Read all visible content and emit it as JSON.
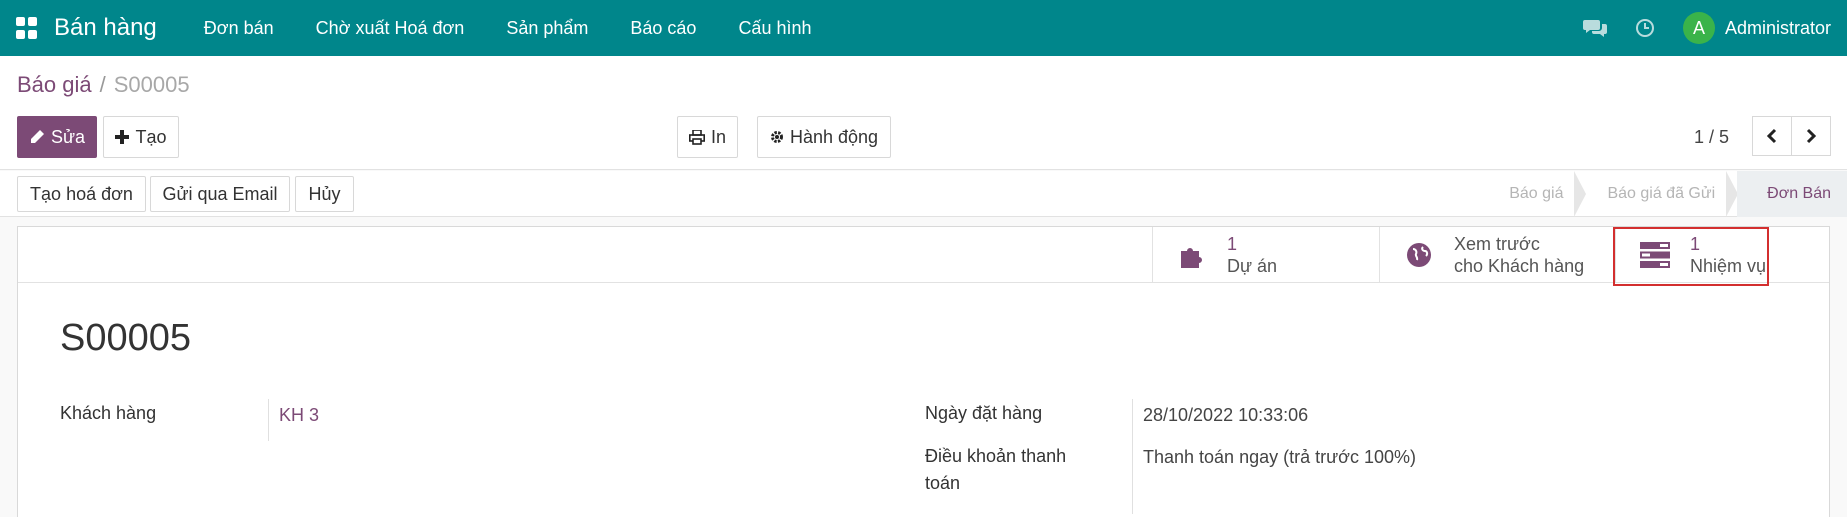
{
  "navbar": {
    "brand": "Bán hàng",
    "menu": [
      "Đơn bán",
      "Chờ xuất Hoá đơn",
      "Sản phẩm",
      "Báo cáo",
      "Cấu hình"
    ],
    "avatar_letter": "A",
    "user": "Administrator"
  },
  "breadcrumb": {
    "parent": "Báo giá",
    "separator": "/",
    "current": "S00005"
  },
  "toolbar": {
    "edit": "Sửa",
    "create": "Tạo",
    "print": "In",
    "action": "Hành động"
  },
  "pager": {
    "text": "1 / 5"
  },
  "statusbar": {
    "actions": [
      "Tạo hoá đơn",
      "Gửi qua Email",
      "Hủy"
    ],
    "steps": [
      "Báo giá",
      "Báo giá đã Gửi",
      "Đơn Bán"
    ]
  },
  "smart_buttons": {
    "project": {
      "value": "1",
      "label": "Dự án"
    },
    "preview": {
      "line1": "Xem trước",
      "line2": "cho Khách hàng"
    },
    "task": {
      "value": "1",
      "label": "Nhiệm vụ"
    }
  },
  "form": {
    "title": "S00005",
    "customer_label": "Khách hàng",
    "customer_value": "KH 3",
    "date_label": "Ngày đặt hàng",
    "date_value": "28/10/2022 10:33:06",
    "terms_label_1": "Điều khoản thanh",
    "terms_label_2": "toán",
    "terms_value": "Thanh toán ngay (trả trước 100%)"
  },
  "colors": {
    "navbar": "#00868b",
    "primary": "#7c4a76",
    "highlight": "#d32f2f"
  }
}
